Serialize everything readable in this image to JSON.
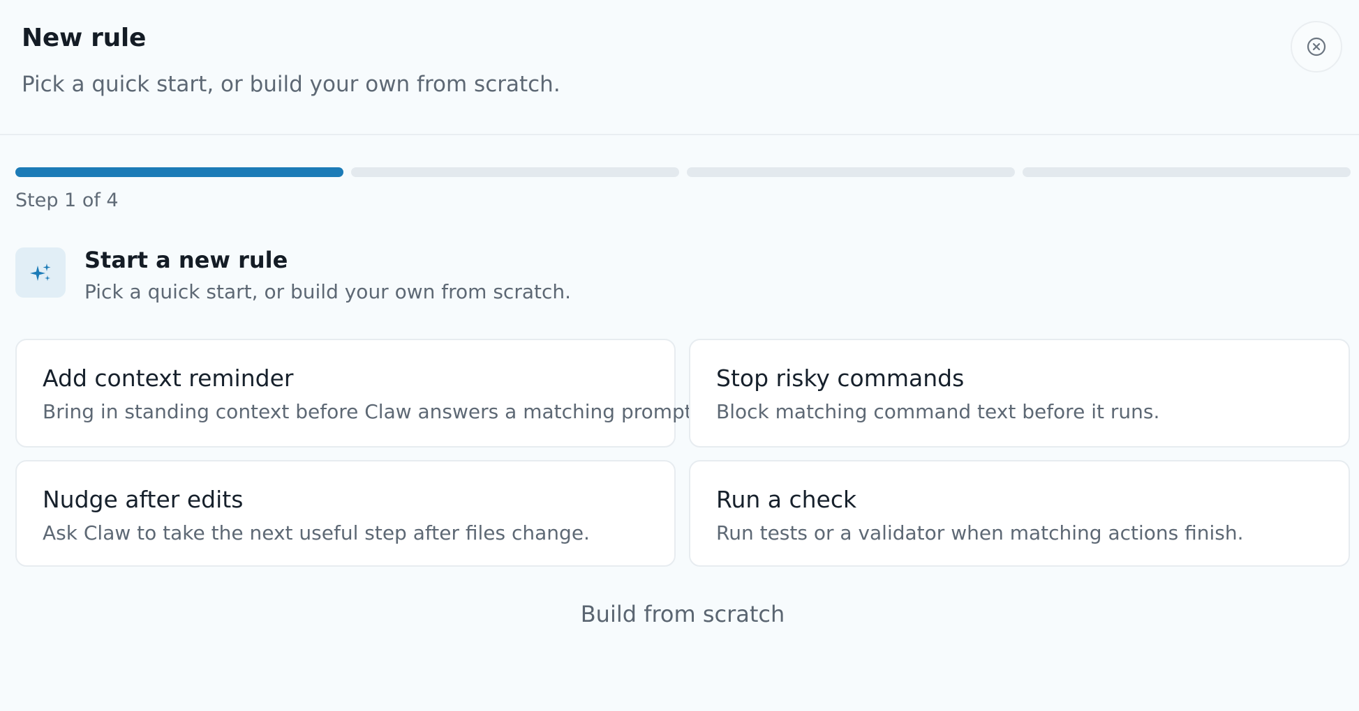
{
  "header": {
    "title": "New rule",
    "subtitle": "Pick a quick start, or build your own from scratch.",
    "close_icon": "close-circle-icon"
  },
  "progress": {
    "current_step": 1,
    "total_steps": 4,
    "label": "Step 1 of 4",
    "active_color": "#1c7bb7",
    "inactive_color": "#e3e9ee"
  },
  "section": {
    "icon": "sparkles-icon",
    "title": "Start a new rule",
    "subtitle": "Pick a quick start, or build your own from scratch."
  },
  "quick_starts": [
    {
      "title": "Add context reminder",
      "description": "Bring in standing context before Claw answers a matching prompt."
    },
    {
      "title": "Stop risky commands",
      "description": "Block matching command text before it runs."
    },
    {
      "title": "Nudge after edits",
      "description": "Ask Claw to take the next useful step after files change."
    },
    {
      "title": "Run a check",
      "description": "Run tests or a validator when matching actions finish."
    }
  ],
  "build_from_scratch_label": "Build from scratch"
}
